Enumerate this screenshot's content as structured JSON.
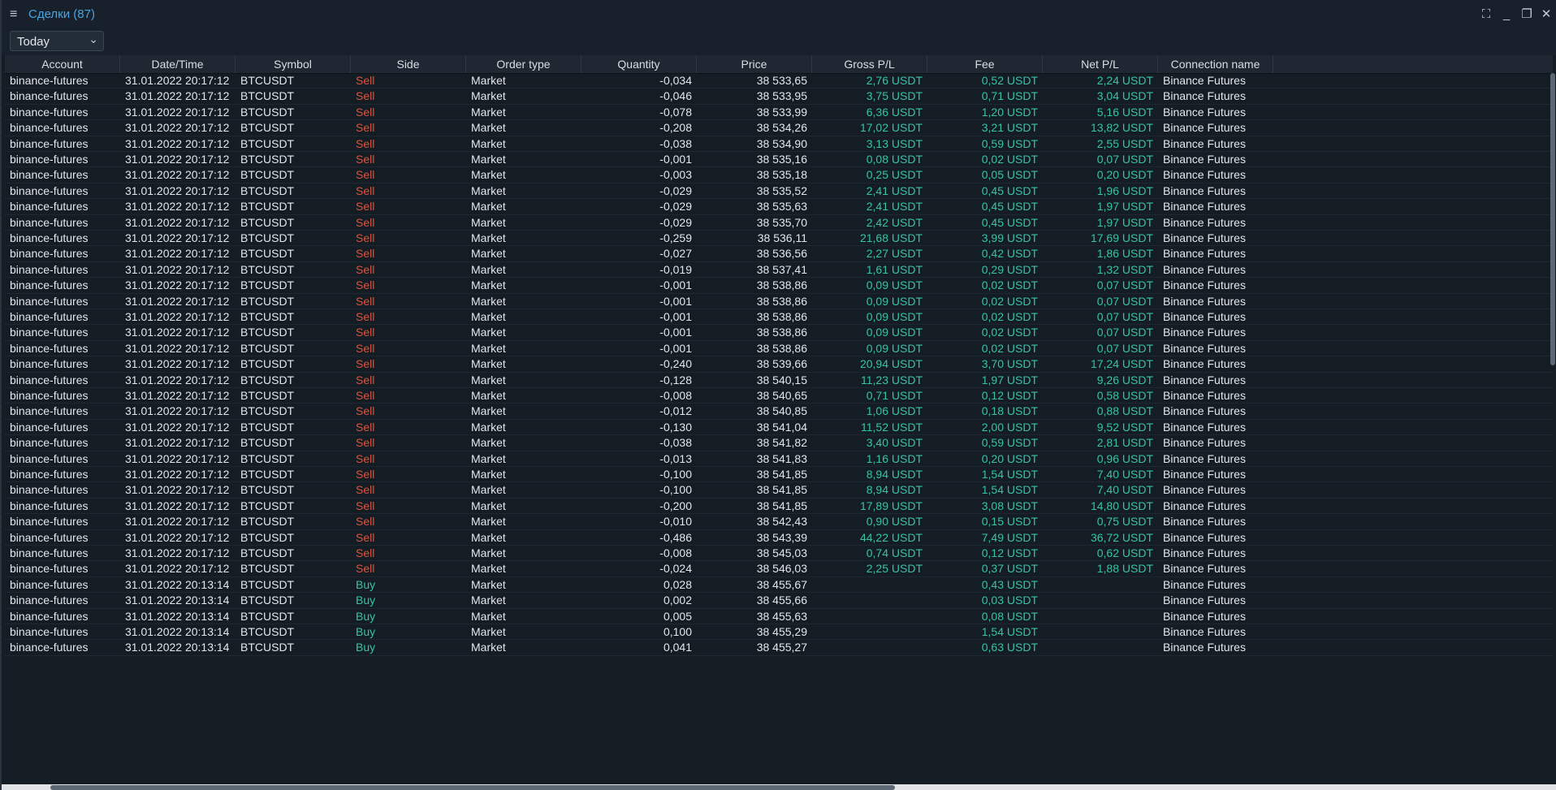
{
  "window": {
    "title": "Сделки (87)",
    "menu_icon": "hamburger-icon",
    "controls": [
      "expand-icon",
      "minimize-icon",
      "restore-icon",
      "close-icon"
    ]
  },
  "filter": {
    "period": "Today"
  },
  "columns": [
    {
      "key": "account",
      "label": "Account"
    },
    {
      "key": "datetime",
      "label": "Date/Time"
    },
    {
      "key": "symbol",
      "label": "Symbol"
    },
    {
      "key": "side",
      "label": "Side"
    },
    {
      "key": "order_type",
      "label": "Order type"
    },
    {
      "key": "quantity",
      "label": "Quantity"
    },
    {
      "key": "price",
      "label": "Price"
    },
    {
      "key": "gross_pl",
      "label": "Gross P/L"
    },
    {
      "key": "fee",
      "label": "Fee"
    },
    {
      "key": "net_pl",
      "label": "Net P/L"
    },
    {
      "key": "connection",
      "label": "Connection name"
    }
  ],
  "colors": {
    "sell": "#e0533b",
    "buy": "#37c3a8",
    "profit": "#37c3a8",
    "title": "#4aa3df"
  },
  "rows": [
    [
      "binance-futures",
      "31.01.2022 20:17:12",
      "BTCUSDT",
      "Sell",
      "Market",
      "-0,034",
      "38 533,65",
      "2,76 USDT",
      "0,52 USDT",
      "2,24 USDT",
      "Binance Futures"
    ],
    [
      "binance-futures",
      "31.01.2022 20:17:12",
      "BTCUSDT",
      "Sell",
      "Market",
      "-0,046",
      "38 533,95",
      "3,75 USDT",
      "0,71 USDT",
      "3,04 USDT",
      "Binance Futures"
    ],
    [
      "binance-futures",
      "31.01.2022 20:17:12",
      "BTCUSDT",
      "Sell",
      "Market",
      "-0,078",
      "38 533,99",
      "6,36 USDT",
      "1,20 USDT",
      "5,16 USDT",
      "Binance Futures"
    ],
    [
      "binance-futures",
      "31.01.2022 20:17:12",
      "BTCUSDT",
      "Sell",
      "Market",
      "-0,208",
      "38 534,26",
      "17,02 USDT",
      "3,21 USDT",
      "13,82 USDT",
      "Binance Futures"
    ],
    [
      "binance-futures",
      "31.01.2022 20:17:12",
      "BTCUSDT",
      "Sell",
      "Market",
      "-0,038",
      "38 534,90",
      "3,13 USDT",
      "0,59 USDT",
      "2,55 USDT",
      "Binance Futures"
    ],
    [
      "binance-futures",
      "31.01.2022 20:17:12",
      "BTCUSDT",
      "Sell",
      "Market",
      "-0,001",
      "38 535,16",
      "0,08 USDT",
      "0,02 USDT",
      "0,07 USDT",
      "Binance Futures"
    ],
    [
      "binance-futures",
      "31.01.2022 20:17:12",
      "BTCUSDT",
      "Sell",
      "Market",
      "-0,003",
      "38 535,18",
      "0,25 USDT",
      "0,05 USDT",
      "0,20 USDT",
      "Binance Futures"
    ],
    [
      "binance-futures",
      "31.01.2022 20:17:12",
      "BTCUSDT",
      "Sell",
      "Market",
      "-0,029",
      "38 535,52",
      "2,41 USDT",
      "0,45 USDT",
      "1,96 USDT",
      "Binance Futures"
    ],
    [
      "binance-futures",
      "31.01.2022 20:17:12",
      "BTCUSDT",
      "Sell",
      "Market",
      "-0,029",
      "38 535,63",
      "2,41 USDT",
      "0,45 USDT",
      "1,97 USDT",
      "Binance Futures"
    ],
    [
      "binance-futures",
      "31.01.2022 20:17:12",
      "BTCUSDT",
      "Sell",
      "Market",
      "-0,029",
      "38 535,70",
      "2,42 USDT",
      "0,45 USDT",
      "1,97 USDT",
      "Binance Futures"
    ],
    [
      "binance-futures",
      "31.01.2022 20:17:12",
      "BTCUSDT",
      "Sell",
      "Market",
      "-0,259",
      "38 536,11",
      "21,68 USDT",
      "3,99 USDT",
      "17,69 USDT",
      "Binance Futures"
    ],
    [
      "binance-futures",
      "31.01.2022 20:17:12",
      "BTCUSDT",
      "Sell",
      "Market",
      "-0,027",
      "38 536,56",
      "2,27 USDT",
      "0,42 USDT",
      "1,86 USDT",
      "Binance Futures"
    ],
    [
      "binance-futures",
      "31.01.2022 20:17:12",
      "BTCUSDT",
      "Sell",
      "Market",
      "-0,019",
      "38 537,41",
      "1,61 USDT",
      "0,29 USDT",
      "1,32 USDT",
      "Binance Futures"
    ],
    [
      "binance-futures",
      "31.01.2022 20:17:12",
      "BTCUSDT",
      "Sell",
      "Market",
      "-0,001",
      "38 538,86",
      "0,09 USDT",
      "0,02 USDT",
      "0,07 USDT",
      "Binance Futures"
    ],
    [
      "binance-futures",
      "31.01.2022 20:17:12",
      "BTCUSDT",
      "Sell",
      "Market",
      "-0,001",
      "38 538,86",
      "0,09 USDT",
      "0,02 USDT",
      "0,07 USDT",
      "Binance Futures"
    ],
    [
      "binance-futures",
      "31.01.2022 20:17:12",
      "BTCUSDT",
      "Sell",
      "Market",
      "-0,001",
      "38 538,86",
      "0,09 USDT",
      "0,02 USDT",
      "0,07 USDT",
      "Binance Futures"
    ],
    [
      "binance-futures",
      "31.01.2022 20:17:12",
      "BTCUSDT",
      "Sell",
      "Market",
      "-0,001",
      "38 538,86",
      "0,09 USDT",
      "0,02 USDT",
      "0,07 USDT",
      "Binance Futures"
    ],
    [
      "binance-futures",
      "31.01.2022 20:17:12",
      "BTCUSDT",
      "Sell",
      "Market",
      "-0,001",
      "38 538,86",
      "0,09 USDT",
      "0,02 USDT",
      "0,07 USDT",
      "Binance Futures"
    ],
    [
      "binance-futures",
      "31.01.2022 20:17:12",
      "BTCUSDT",
      "Sell",
      "Market",
      "-0,240",
      "38 539,66",
      "20,94 USDT",
      "3,70 USDT",
      "17,24 USDT",
      "Binance Futures"
    ],
    [
      "binance-futures",
      "31.01.2022 20:17:12",
      "BTCUSDT",
      "Sell",
      "Market",
      "-0,128",
      "38 540,15",
      "11,23 USDT",
      "1,97 USDT",
      "9,26 USDT",
      "Binance Futures"
    ],
    [
      "binance-futures",
      "31.01.2022 20:17:12",
      "BTCUSDT",
      "Sell",
      "Market",
      "-0,008",
      "38 540,65",
      "0,71 USDT",
      "0,12 USDT",
      "0,58 USDT",
      "Binance Futures"
    ],
    [
      "binance-futures",
      "31.01.2022 20:17:12",
      "BTCUSDT",
      "Sell",
      "Market",
      "-0,012",
      "38 540,85",
      "1,06 USDT",
      "0,18 USDT",
      "0,88 USDT",
      "Binance Futures"
    ],
    [
      "binance-futures",
      "31.01.2022 20:17:12",
      "BTCUSDT",
      "Sell",
      "Market",
      "-0,130",
      "38 541,04",
      "11,52 USDT",
      "2,00 USDT",
      "9,52 USDT",
      "Binance Futures"
    ],
    [
      "binance-futures",
      "31.01.2022 20:17:12",
      "BTCUSDT",
      "Sell",
      "Market",
      "-0,038",
      "38 541,82",
      "3,40 USDT",
      "0,59 USDT",
      "2,81 USDT",
      "Binance Futures"
    ],
    [
      "binance-futures",
      "31.01.2022 20:17:12",
      "BTCUSDT",
      "Sell",
      "Market",
      "-0,013",
      "38 541,83",
      "1,16 USDT",
      "0,20 USDT",
      "0,96 USDT",
      "Binance Futures"
    ],
    [
      "binance-futures",
      "31.01.2022 20:17:12",
      "BTCUSDT",
      "Sell",
      "Market",
      "-0,100",
      "38 541,85",
      "8,94 USDT",
      "1,54 USDT",
      "7,40 USDT",
      "Binance Futures"
    ],
    [
      "binance-futures",
      "31.01.2022 20:17:12",
      "BTCUSDT",
      "Sell",
      "Market",
      "-0,100",
      "38 541,85",
      "8,94 USDT",
      "1,54 USDT",
      "7,40 USDT",
      "Binance Futures"
    ],
    [
      "binance-futures",
      "31.01.2022 20:17:12",
      "BTCUSDT",
      "Sell",
      "Market",
      "-0,200",
      "38 541,85",
      "17,89 USDT",
      "3,08 USDT",
      "14,80 USDT",
      "Binance Futures"
    ],
    [
      "binance-futures",
      "31.01.2022 20:17:12",
      "BTCUSDT",
      "Sell",
      "Market",
      "-0,010",
      "38 542,43",
      "0,90 USDT",
      "0,15 USDT",
      "0,75 USDT",
      "Binance Futures"
    ],
    [
      "binance-futures",
      "31.01.2022 20:17:12",
      "BTCUSDT",
      "Sell",
      "Market",
      "-0,486",
      "38 543,39",
      "44,22 USDT",
      "7,49 USDT",
      "36,72 USDT",
      "Binance Futures"
    ],
    [
      "binance-futures",
      "31.01.2022 20:17:12",
      "BTCUSDT",
      "Sell",
      "Market",
      "-0,008",
      "38 545,03",
      "0,74 USDT",
      "0,12 USDT",
      "0,62 USDT",
      "Binance Futures"
    ],
    [
      "binance-futures",
      "31.01.2022 20:17:12",
      "BTCUSDT",
      "Sell",
      "Market",
      "-0,024",
      "38 546,03",
      "2,25 USDT",
      "0,37 USDT",
      "1,88 USDT",
      "Binance Futures"
    ],
    [
      "binance-futures",
      "31.01.2022 20:13:14",
      "BTCUSDT",
      "Buy",
      "Market",
      "0,028",
      "38 455,67",
      "",
      "0,43 USDT",
      "",
      "Binance Futures"
    ],
    [
      "binance-futures",
      "31.01.2022 20:13:14",
      "BTCUSDT",
      "Buy",
      "Market",
      "0,002",
      "38 455,66",
      "",
      "0,03 USDT",
      "",
      "Binance Futures"
    ],
    [
      "binance-futures",
      "31.01.2022 20:13:14",
      "BTCUSDT",
      "Buy",
      "Market",
      "0,005",
      "38 455,63",
      "",
      "0,08 USDT",
      "",
      "Binance Futures"
    ],
    [
      "binance-futures",
      "31.01.2022 20:13:14",
      "BTCUSDT",
      "Buy",
      "Market",
      "0,100",
      "38 455,29",
      "",
      "1,54 USDT",
      "",
      "Binance Futures"
    ],
    [
      "binance-futures",
      "31.01.2022 20:13:14",
      "BTCUSDT",
      "Buy",
      "Market",
      "0,041",
      "38 455,27",
      "",
      "0,63 USDT",
      "",
      "Binance Futures"
    ]
  ]
}
